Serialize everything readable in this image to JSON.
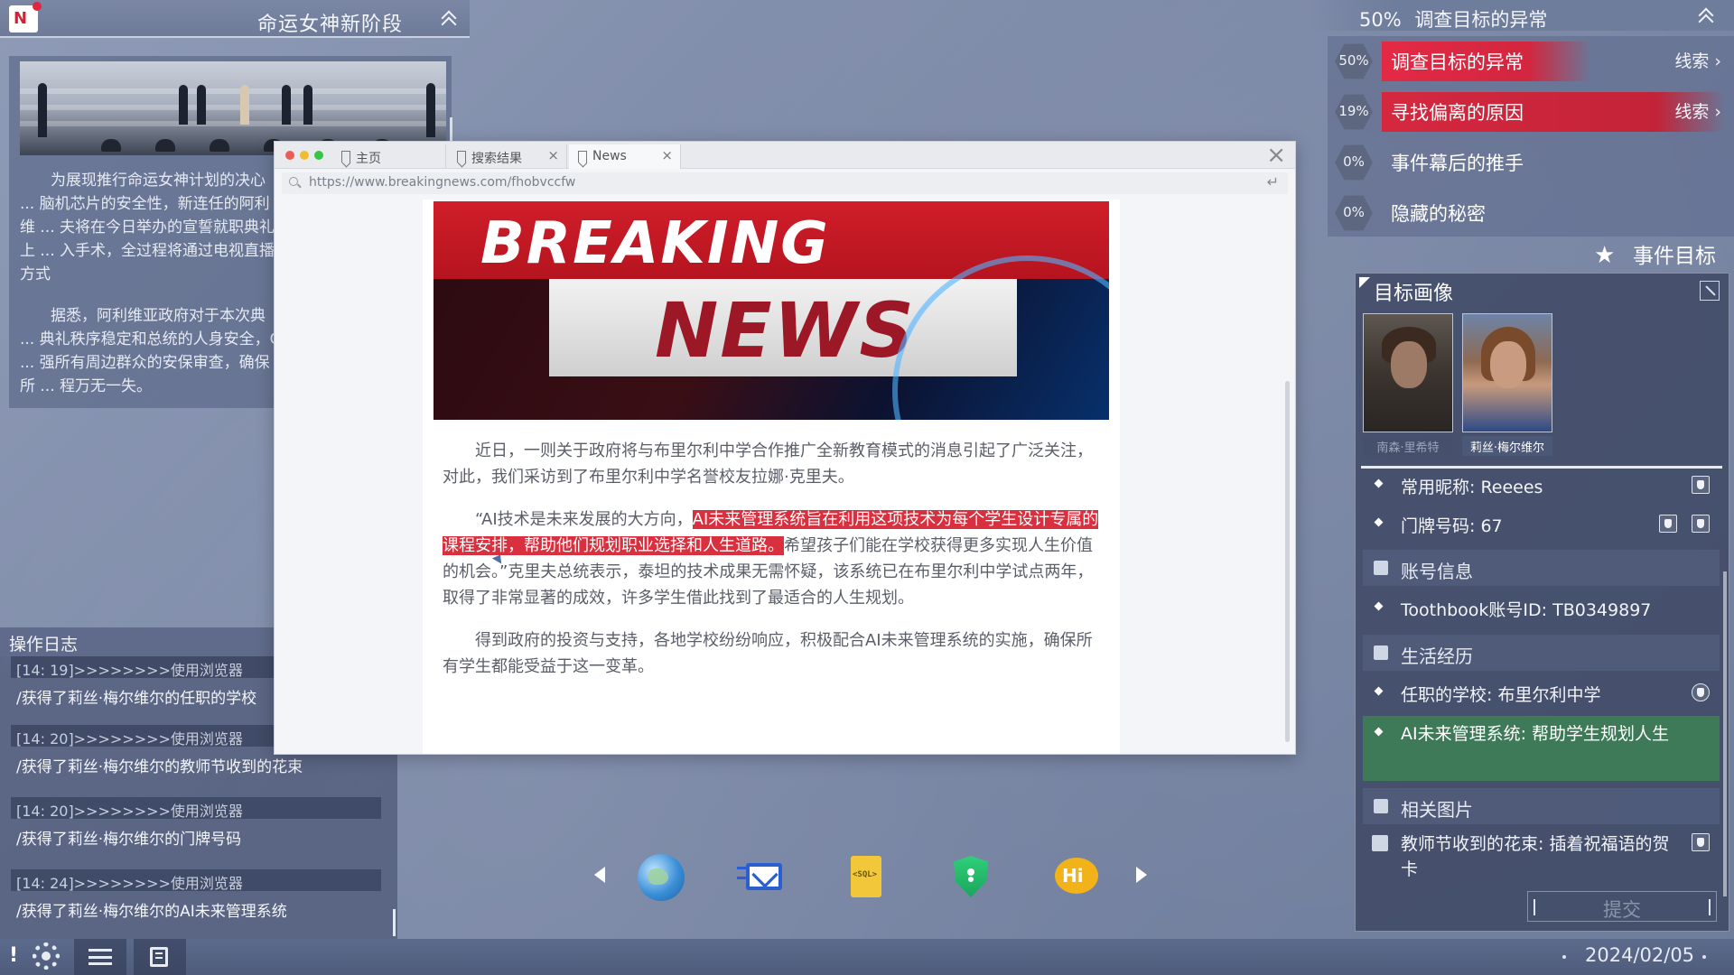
{
  "topbar": {
    "title": "命运女神新阶段",
    "progress": "50%",
    "progress_label": "调查目标的异常"
  },
  "left_panel": {
    "paragraphs": [
      "为展现推行命运女神计划的决心 ... 脑机芯片的安全性，新连任的阿利维 ... 夫将在今日举办的宣誓就职典礼上 ... 入手术，全过程将通过电视直播方式",
      "据悉，阿利维亚政府对于本次典 ... 典礼秩序稳定和总统的人身安全，C ... 强所有周边群众的安保审查，确保所 ... 程万无一失。"
    ]
  },
  "oplog": {
    "title": "操作日志",
    "entries": [
      {
        "head": "[14: 19]>>>>>>>>使用浏览器",
        "body": "/获得了莉丝·梅尔维尔的任职的学校"
      },
      {
        "head": "[14: 20]>>>>>>>>使用浏览器",
        "body": "/获得了莉丝·梅尔维尔的教师节收到的花束"
      },
      {
        "head": "[14: 20]>>>>>>>>使用浏览器",
        "body": "/获得了莉丝·梅尔维尔的门牌号码"
      },
      {
        "head": "[14: 24]>>>>>>>>使用浏览器",
        "body": "/获得了莉丝·梅尔维尔的AI未来管理系统"
      }
    ]
  },
  "browser": {
    "tabs": [
      "主页",
      "搜索结果",
      "News"
    ],
    "url": "https://www.breakingnews.com/fhobvccfw",
    "banner_top": "BREAKING",
    "banner_bottom": "NEWS",
    "p1": "近日，一则关于政府将与布里尔利中学合作推广全新教育模式的消息引起了广泛关注，对此，我们采访到了布里尔利中学名誉校友拉娜·克里夫。",
    "p2_before": "“AI技术是未来发展的大方向，",
    "p2_highlight": "AI未来管理系统旨在利用这项技术为每个学生设计专属的课程安排，帮助他们规划职业选择和人生道路。",
    "p2_after": "希望孩子们能在学校获得更多实现人生价值的机会。”克里夫总统表示，泰坦的技术成果无需怀疑，该系统已在布里尔利中学试点两年，取得了非常显著的成效，许多学生借此找到了最适合的人生规划。",
    "p3": "得到政府的投资与支持，各地学校纷纷响应，积极配合AI未来管理系统的实施，确保所有学生都能受益于这一变革。"
  },
  "quests": [
    {
      "pct": "50%",
      "label": "调查目标的异常",
      "clue": "线索",
      "active": true,
      "fill": 0.5
    },
    {
      "pct": "19%",
      "label": "寻找偏离的原因",
      "clue": "线索",
      "active": true,
      "fill": 0.19
    },
    {
      "pct": "0%",
      "label": "事件幕后的推手",
      "clue": "",
      "active": false,
      "fill": 0
    },
    {
      "pct": "0%",
      "label": "隐藏的秘密",
      "clue": "",
      "active": false,
      "fill": 0
    }
  ],
  "event_goal": "事件目标",
  "profile": {
    "title": "目标画像",
    "avatars": [
      {
        "name": "南森·里希特"
      },
      {
        "name": "莉丝·梅尔维尔"
      }
    ],
    "nickname": "常用昵称: Reeees",
    "door": "门牌号码: 67",
    "account_head": "账号信息",
    "account_id": "Toothbook账号ID: TB0349897",
    "life_head": "生活经历",
    "school": "任职的学校: 布里尔利中学",
    "ai_system": "AI未来管理系统: 帮助学生规划人生",
    "images_head": "相关图片",
    "flowers": "教师节收到的花束: 插着祝福语的贺卡",
    "submit": "提交"
  },
  "bottom": {
    "excl": "!",
    "date": "2024/02/05"
  },
  "colors": {
    "accent_red": "#e32a45",
    "highlight_green": "#3f7a58",
    "panel": "#3c4662"
  }
}
